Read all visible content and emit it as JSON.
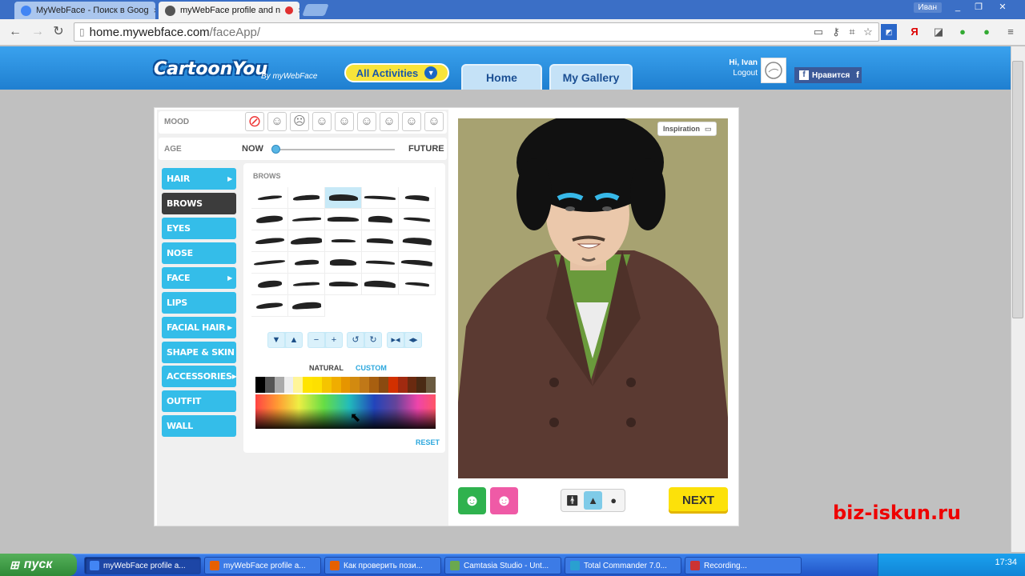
{
  "browser": {
    "tabs": [
      {
        "title": "MyWebFace - Поиск в Goog",
        "close": "×"
      },
      {
        "title": "myWebFace profile and n",
        "close": "×"
      }
    ],
    "user": "Иван",
    "window_controls": [
      "_",
      "❐",
      "✕"
    ],
    "url_host": "home.mywebface.com",
    "url_path": "/faceApp/"
  },
  "site": {
    "logo": "CartoonYou",
    "logo_sub": "By myWebFace",
    "all_activities": "All Activities",
    "nav": [
      "Home",
      "My Gallery"
    ],
    "greeting": "Hi, Ivan",
    "logout": "Logout",
    "fb_like": "Нравится"
  },
  "editor": {
    "mood_label": "MOOD",
    "age_label": "AGE",
    "age_now": "NOW",
    "age_future": "FUTURE",
    "age_value": 0.0,
    "categories": [
      "HAIR",
      "BROWS",
      "EYES",
      "NOSE",
      "FACE",
      "LIPS",
      "FACIAL HAIR",
      "SHAPE & SKIN",
      "ACCESSORIES",
      "OUTFIT",
      "WALL"
    ],
    "selected_category": "BROWS",
    "panel_title": "BROWS",
    "color_tabs": [
      "NATURAL",
      "CUSTOM"
    ],
    "reset": "RESET",
    "inspiration": "Inspiration",
    "next": "NEXT"
  },
  "watermark": "biz-iskun.ru",
  "taskbar": {
    "start": "пуск",
    "items": [
      "myWebFace profile a...",
      "myWebFace profile a...",
      "Как проверить пози...",
      "Camtasia Studio - Unt...",
      "Total Commander 7.0...",
      "Recording..."
    ],
    "clock": "17:34"
  },
  "colors": {
    "header_blue": "#2a8edb",
    "category_blue": "#34bde9",
    "next_yellow": "#fce10a",
    "watermark_red": "#e00000"
  }
}
